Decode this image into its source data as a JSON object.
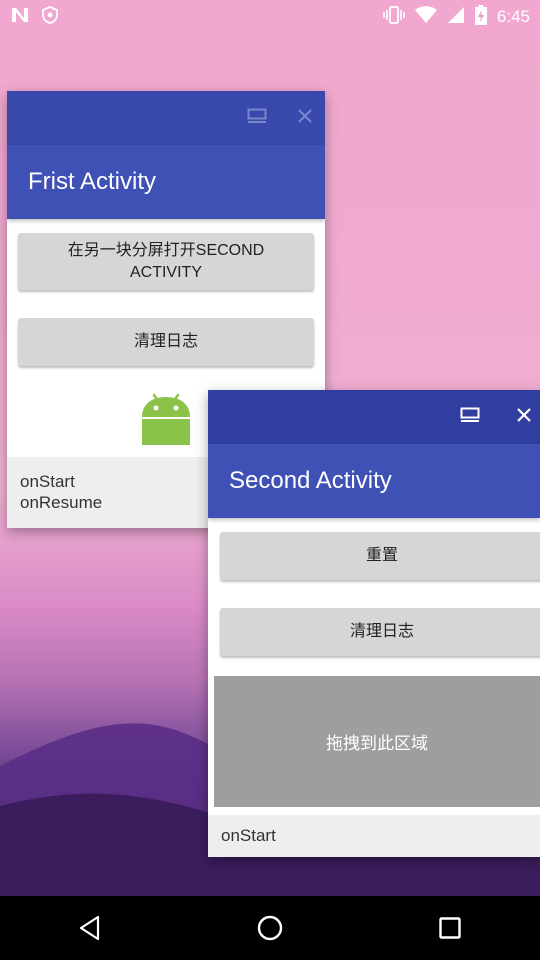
{
  "status_bar": {
    "time": "6:45",
    "icons_left": [
      "n-icon",
      "shield-icon"
    ],
    "icons_right": [
      "vibrate-icon",
      "wifi-icon",
      "signal-icon",
      "battery-charging-icon"
    ]
  },
  "window1": {
    "title": "Frist Activity",
    "open_second_button": "在另一块分屏打开SECOND ACTIVITY",
    "clear_log_button": "清理日志",
    "log_lines": [
      "onStart",
      "onResume"
    ],
    "image": "android-robot-icon"
  },
  "window2": {
    "title": "Second Activity",
    "reset_button": "重置",
    "clear_log_button": "清理日志",
    "drop_area_text": "拖拽到此区域",
    "log_lines": [
      "onStart"
    ]
  },
  "colors": {
    "caption": "#3949ab",
    "appbar": "#3f51b5",
    "button": "#d6d6d6"
  }
}
